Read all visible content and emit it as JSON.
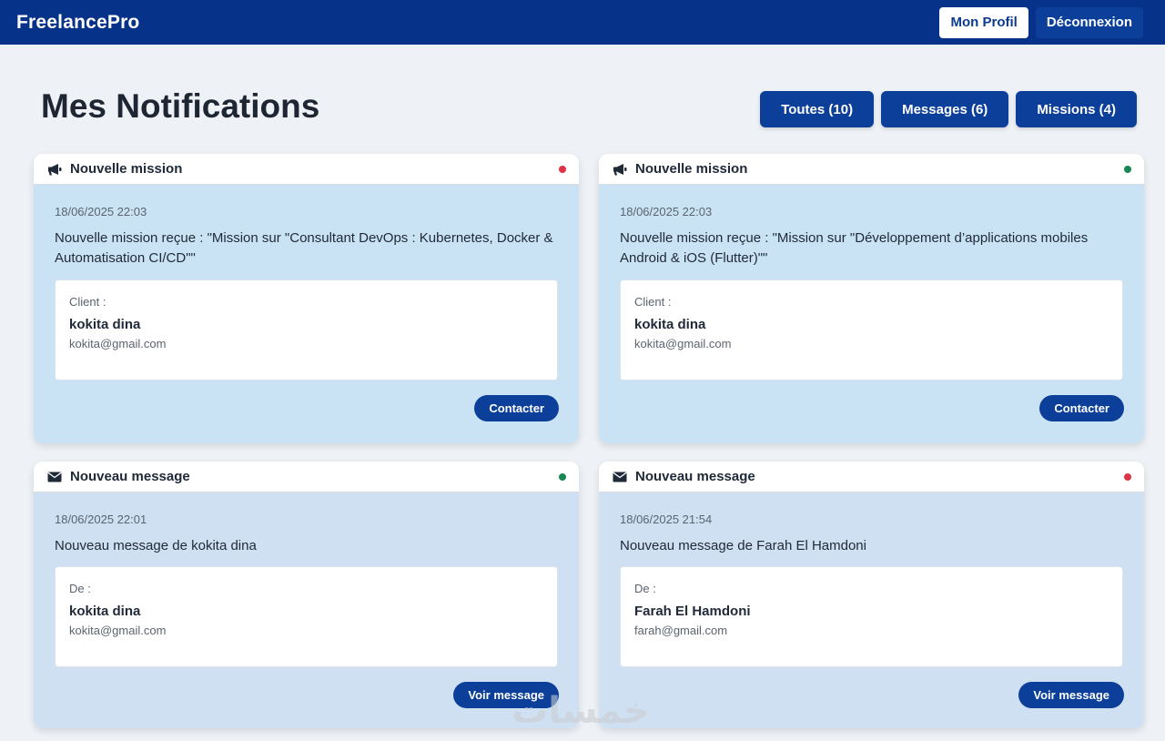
{
  "navbar": {
    "brand": "FreelancePro",
    "profile_label": "Mon Profil",
    "logout_label": "Déconnexion"
  },
  "page": {
    "title": "Mes Notifications"
  },
  "filters": [
    {
      "label": "Toutes (10)"
    },
    {
      "label": "Messages (6)"
    },
    {
      "label": "Missions (4)"
    }
  ],
  "colors": {
    "navbar": "#063289",
    "accent": "#0b3f9a",
    "unread_dot": "#dc3545",
    "read_dot": "#198754",
    "mission_bg": "#c9e3f4",
    "message_bg": "#cfe0f2"
  },
  "notifications": [
    {
      "type": "mission",
      "icon": "megaphone-icon",
      "header": "Nouvelle mission",
      "status": "unread",
      "timestamp": "18/06/2025 22:03",
      "text": "Nouvelle mission reçue : \"Mission sur \"Consultant DevOps : Kubernetes, Docker & Automatisation CI/CD\"\"",
      "contact_label": "Client :",
      "contact_name": "kokita dina",
      "contact_email": "kokita@gmail.com",
      "action_label": "Contacter"
    },
    {
      "type": "mission",
      "icon": "megaphone-icon",
      "header": "Nouvelle mission",
      "status": "read",
      "timestamp": "18/06/2025 22:03",
      "text": "Nouvelle mission reçue : \"Mission sur \"Développement d’applications mobiles Android & iOS (Flutter)\"\"",
      "contact_label": "Client :",
      "contact_name": "kokita dina",
      "contact_email": "kokita@gmail.com",
      "action_label": "Contacter"
    },
    {
      "type": "message",
      "icon": "envelope-icon",
      "header": "Nouveau message",
      "status": "read",
      "timestamp": "18/06/2025 22:01",
      "text": "Nouveau message de kokita dina",
      "contact_label": "De :",
      "contact_name": "kokita dina",
      "contact_email": "kokita@gmail.com",
      "action_label": "Voir message"
    },
    {
      "type": "message",
      "icon": "envelope-icon",
      "header": "Nouveau message",
      "status": "unread",
      "timestamp": "18/06/2025 21:54",
      "text": "Nouveau message de Farah El Hamdoni",
      "contact_label": "De :",
      "contact_name": "Farah El Hamdoni",
      "contact_email": "farah@gmail.com",
      "action_label": "Voir message"
    }
  ],
  "watermark": "خمسات"
}
